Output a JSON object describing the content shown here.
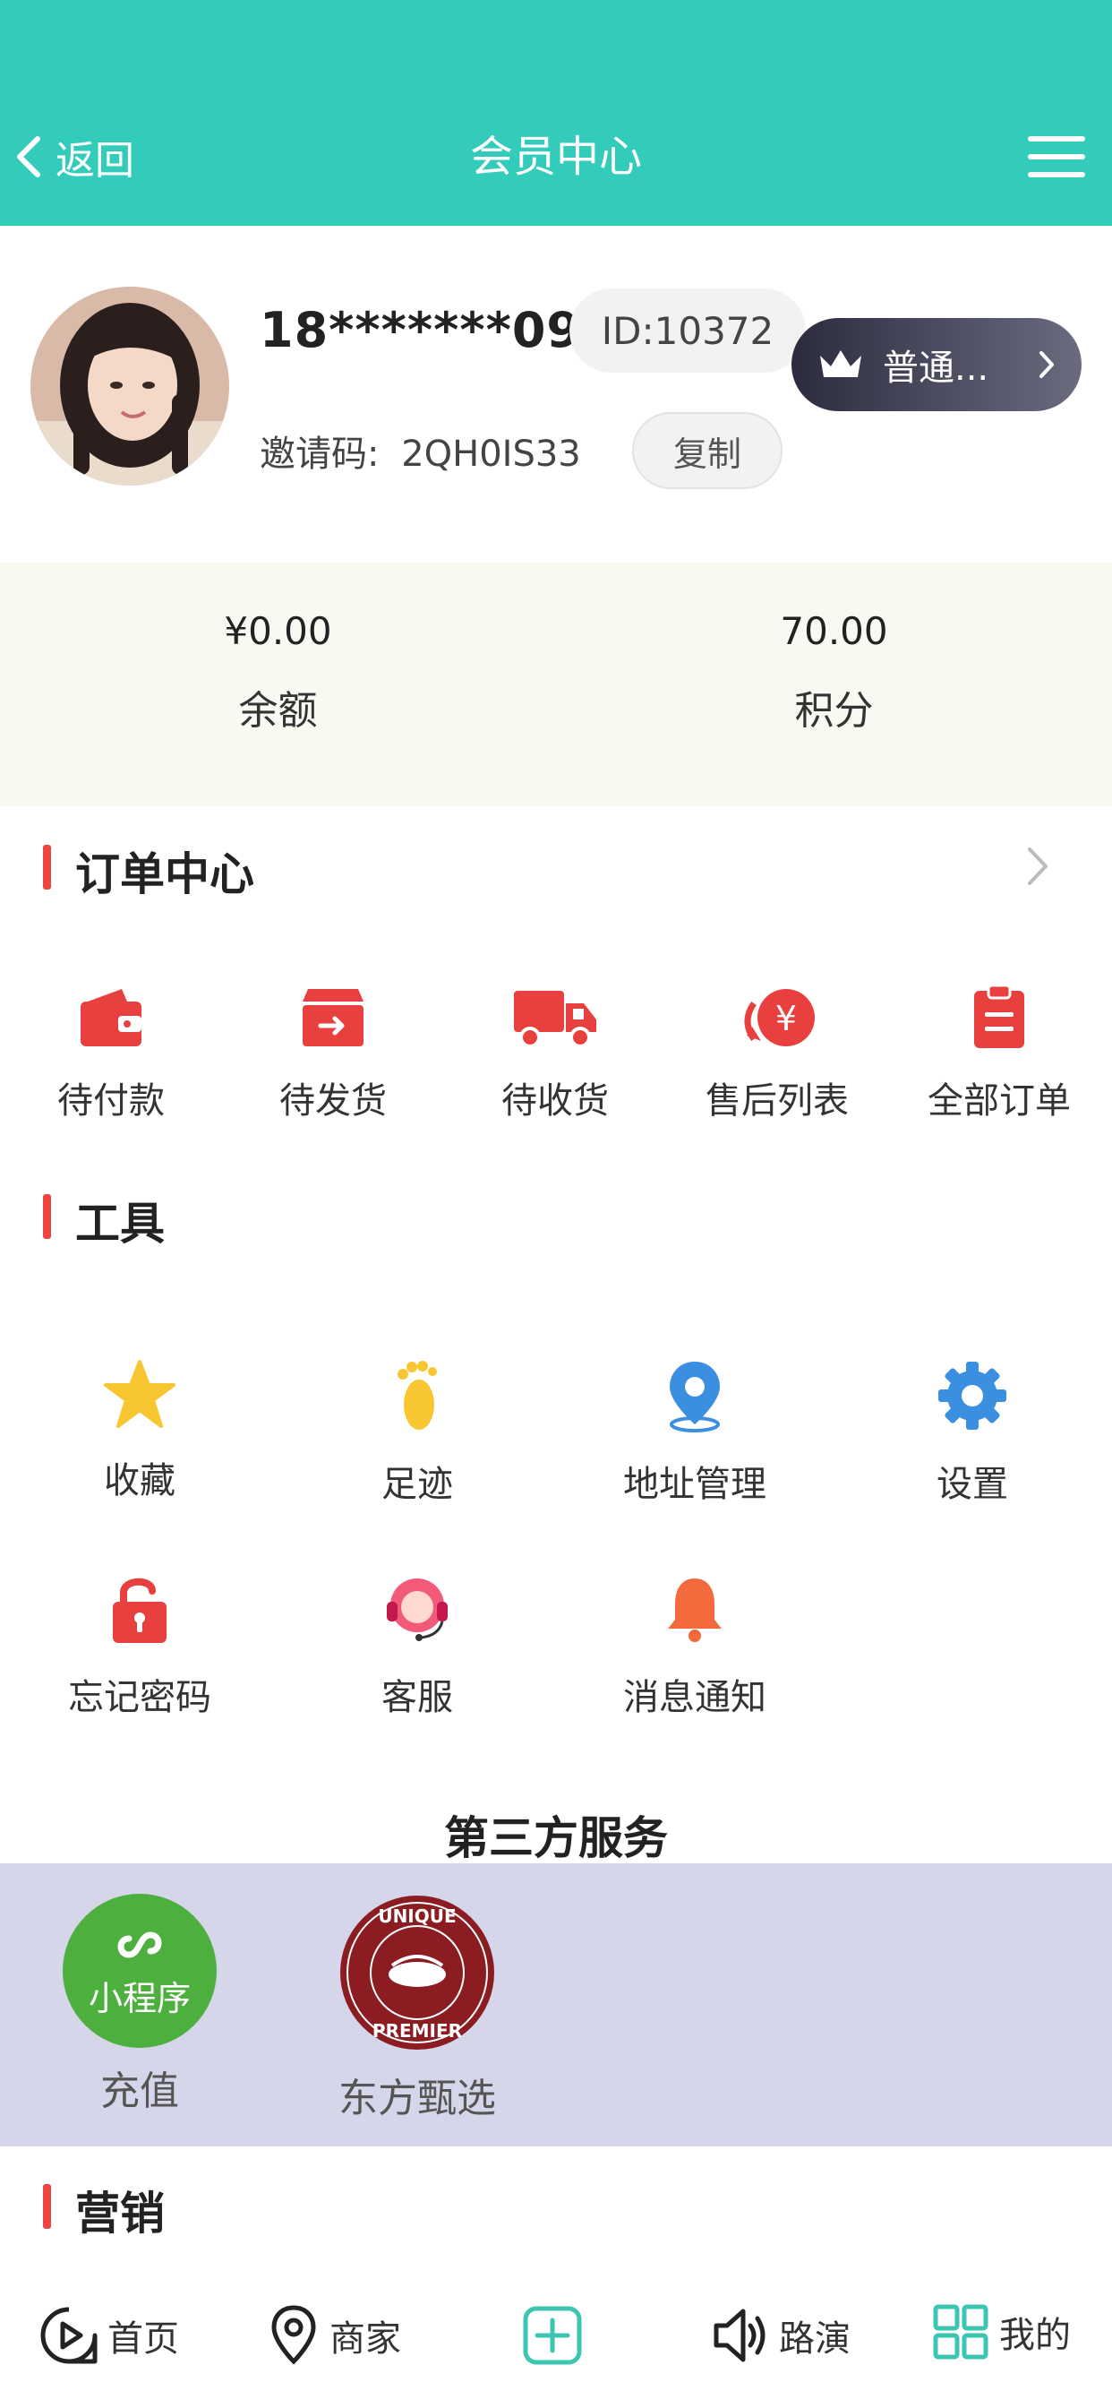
{
  "header": {
    "back_label": "返回",
    "title": "会员中心"
  },
  "profile": {
    "phone": "18*******09",
    "id_text": "ID:10372",
    "level_label": "普通...",
    "invite_label": "邀请码:",
    "invite_code": "2QH0IS33",
    "copy_label": "复制"
  },
  "stats": [
    {
      "value": "¥0.00",
      "label": "余额"
    },
    {
      "value": "70.00",
      "label": "积分"
    }
  ],
  "orders": {
    "title": "订单中心",
    "items": [
      {
        "label": "待付款",
        "icon": "wallet-icon"
      },
      {
        "label": "待发货",
        "icon": "box-icon"
      },
      {
        "label": "待收货",
        "icon": "truck-icon"
      },
      {
        "label": "售后列表",
        "icon": "refund-icon"
      },
      {
        "label": "全部订单",
        "icon": "clipboard-icon"
      }
    ]
  },
  "tools": {
    "title": "工具",
    "items": [
      {
        "label": "收藏",
        "icon": "star-icon"
      },
      {
        "label": "足迹",
        "icon": "footprint-icon"
      },
      {
        "label": "地址管理",
        "icon": "location-pin-icon"
      },
      {
        "label": "设置",
        "icon": "gear-icon"
      },
      {
        "label": "忘记密码",
        "icon": "unlock-icon"
      },
      {
        "label": "客服",
        "icon": "customer-service-icon"
      },
      {
        "label": "消息通知",
        "icon": "bell-icon"
      }
    ]
  },
  "third_party": {
    "title": "第三方服务",
    "items": [
      {
        "label": "充值",
        "badge": "小程序",
        "icon": "mini-program-icon"
      },
      {
        "label": "东方甄选",
        "icon": "unique-premier-logo",
        "logo_text": "UNIQUE PREMIER"
      }
    ]
  },
  "marketing": {
    "title": "营销"
  },
  "bottom_nav": [
    {
      "label": "首页",
      "icon": "home-icon"
    },
    {
      "label": "商家",
      "icon": "location-icon"
    },
    {
      "label": "",
      "icon": "add-icon"
    },
    {
      "label": "路演",
      "icon": "speaker-icon"
    },
    {
      "label": "我的",
      "icon": "grid-icon"
    }
  ],
  "colors": {
    "teal": "#33ccbb",
    "red_accent": "#ee4444",
    "band": "#d6d6ea"
  }
}
